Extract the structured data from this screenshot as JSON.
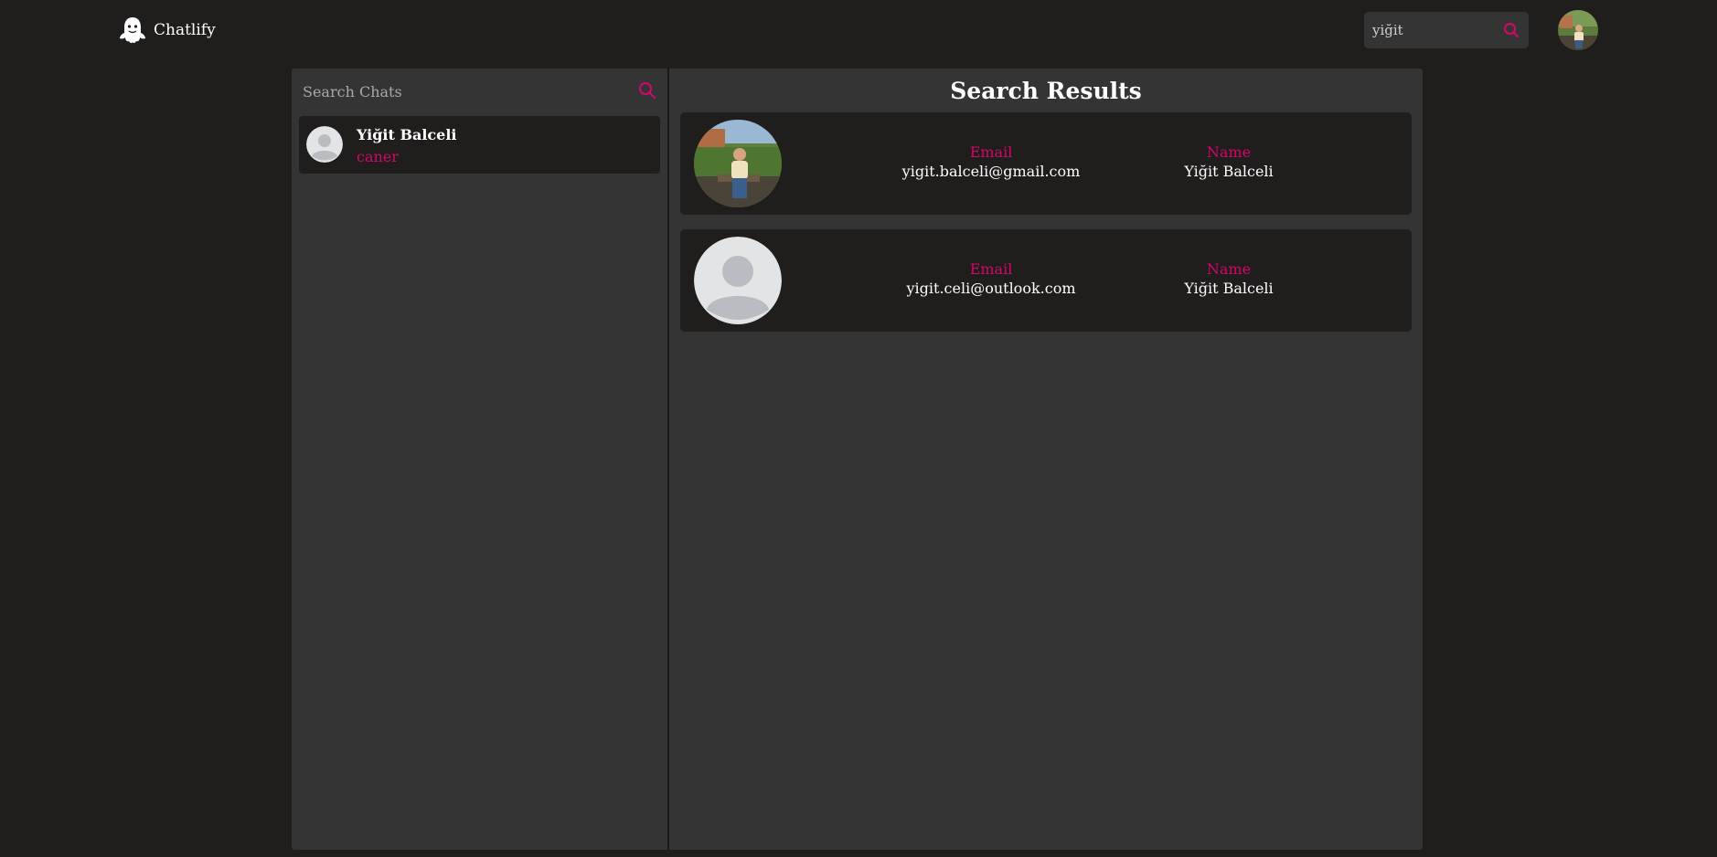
{
  "header": {
    "brand_name": "Chatlify",
    "brand_icon": "ghost-icon",
    "search_value": "yiğit",
    "search_icon": "search-icon"
  },
  "sidebar": {
    "search_placeholder": "Search Chats",
    "chats": [
      {
        "name": "Yiğit Balceli",
        "last_message": "caner",
        "avatar": "default-avatar"
      }
    ]
  },
  "results": {
    "title": "Search Results",
    "items": [
      {
        "email_label": "Email",
        "email": "yigit.balceli@gmail.com",
        "name_label": "Name",
        "name": "Yiğit Balceli",
        "avatar": "photo-avatar"
      },
      {
        "email_label": "Email",
        "email": "yigit.celi@outlook.com",
        "name_label": "Name",
        "name": "Yiğit Balceli",
        "avatar": "default-avatar"
      }
    ]
  },
  "colors": {
    "background": "#201d1d",
    "panel": "#353434",
    "accent": "#d4076a"
  }
}
